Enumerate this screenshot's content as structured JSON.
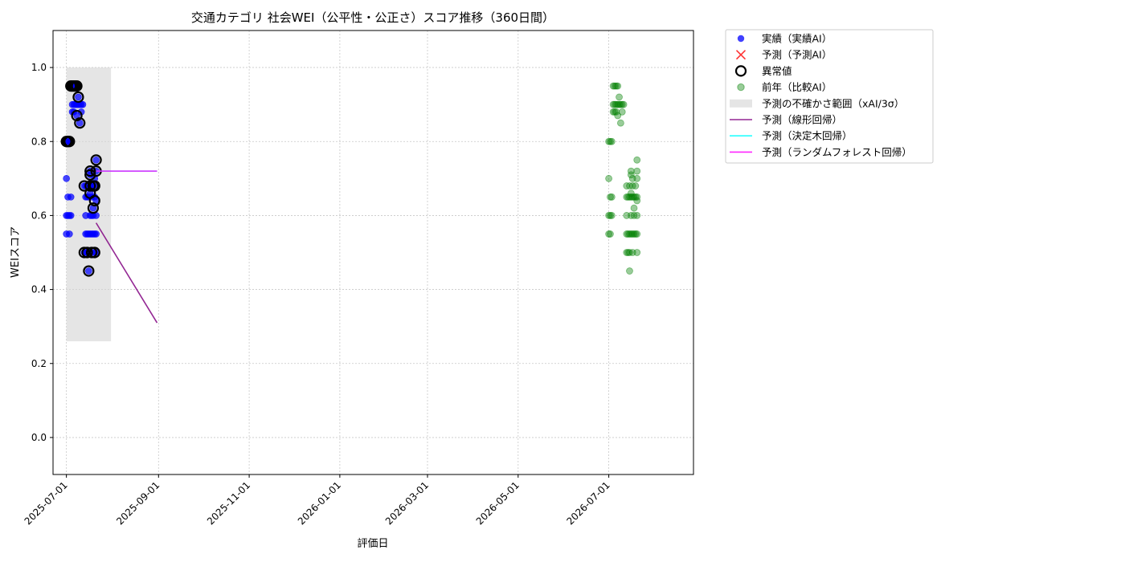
{
  "chart_data": {
    "type": "scatter",
    "title": "交通カテゴリ 社会WEI（公平性・公正さ）スコア推移（360日間）",
    "xlabel": "評価日",
    "ylabel": "WEIスコア",
    "ylim": [
      -0.1,
      1.1
    ],
    "xlim": [
      "2025-06-22",
      "2026-08-27"
    ],
    "yticks": [
      0.0,
      0.2,
      0.4,
      0.6,
      0.8,
      1.0
    ],
    "ytick_labels": [
      "0.0",
      "0.2",
      "0.4",
      "0.6",
      "0.8",
      "1.0"
    ],
    "xticks": [
      "2025-07-01",
      "2025-09-01",
      "2025-11-01",
      "2026-01-01",
      "2026-03-01",
      "2026-05-01",
      "2026-07-01"
    ],
    "grid": true,
    "legend_position": "outside-right",
    "colors": {
      "actual": "#0000ff",
      "predicted": "#ff0000",
      "anomaly_edge": "#000000",
      "prior": "#008000",
      "band": "#d3d3d3",
      "linear": "#800080",
      "tree": "#00ffff",
      "forest": "#ff00ff"
    },
    "legend": [
      {
        "key": "actual",
        "label": "実績（実績AI）",
        "marker": "dot"
      },
      {
        "key": "predicted",
        "label": "予測（予測AI）",
        "marker": "x"
      },
      {
        "key": "anomaly",
        "label": "異常値",
        "marker": "ring"
      },
      {
        "key": "prior",
        "label": "前年（比較AI）",
        "marker": "dot-faded"
      },
      {
        "key": "band",
        "label": "予測の不確かさ範囲（xAI/3σ）",
        "marker": "box"
      },
      {
        "key": "linear",
        "label": "予測（線形回帰）",
        "marker": "line"
      },
      {
        "key": "tree",
        "label": "予測（決定木回帰）",
        "marker": "line"
      },
      {
        "key": "forest",
        "label": "予測（ランダムフォレスト回帰）",
        "marker": "line"
      }
    ],
    "uncertainty_band": {
      "x": [
        "2025-07-01",
        "2025-07-31"
      ],
      "y": [
        0.26,
        1.0
      ]
    },
    "series": [
      {
        "name": "実績（実績AI）",
        "points": [
          [
            "2025-07-01",
            0.8
          ],
          [
            "2025-07-01",
            0.7
          ],
          [
            "2025-07-01",
            0.6
          ],
          [
            "2025-07-01",
            0.55
          ],
          [
            "2025-07-02",
            0.8
          ],
          [
            "2025-07-02",
            0.65
          ],
          [
            "2025-07-02",
            0.6
          ],
          [
            "2025-07-03",
            0.8
          ],
          [
            "2025-07-03",
            0.6
          ],
          [
            "2025-07-03",
            0.55
          ],
          [
            "2025-07-04",
            0.95
          ],
          [
            "2025-07-04",
            0.8
          ],
          [
            "2025-07-04",
            0.65
          ],
          [
            "2025-07-04",
            0.6
          ],
          [
            "2025-07-05",
            0.95
          ],
          [
            "2025-07-05",
            0.9
          ],
          [
            "2025-07-05",
            0.88
          ],
          [
            "2025-07-06",
            0.95
          ],
          [
            "2025-07-06",
            0.9
          ],
          [
            "2025-07-06",
            0.88
          ],
          [
            "2025-07-07",
            0.95
          ],
          [
            "2025-07-07",
            0.9
          ],
          [
            "2025-07-08",
            0.95
          ],
          [
            "2025-07-08",
            0.9
          ],
          [
            "2025-07-08",
            0.87
          ],
          [
            "2025-07-09",
            0.95
          ],
          [
            "2025-07-09",
            0.92
          ],
          [
            "2025-07-09",
            0.9
          ],
          [
            "2025-07-10",
            0.9
          ],
          [
            "2025-07-10",
            0.85
          ],
          [
            "2025-07-11",
            0.9
          ],
          [
            "2025-07-11",
            0.88
          ],
          [
            "2025-07-12",
            0.9
          ],
          [
            "2025-07-13",
            0.68
          ],
          [
            "2025-07-13",
            0.5
          ],
          [
            "2025-07-14",
            0.68
          ],
          [
            "2025-07-14",
            0.65
          ],
          [
            "2025-07-14",
            0.6
          ],
          [
            "2025-07-14",
            0.55
          ],
          [
            "2025-07-14",
            0.5
          ],
          [
            "2025-07-15",
            0.65
          ],
          [
            "2025-07-15",
            0.55
          ],
          [
            "2025-07-15",
            0.5
          ],
          [
            "2025-07-16",
            0.68
          ],
          [
            "2025-07-16",
            0.65
          ],
          [
            "2025-07-16",
            0.55
          ],
          [
            "2025-07-16",
            0.5
          ],
          [
            "2025-07-16",
            0.45
          ],
          [
            "2025-07-17",
            0.72
          ],
          [
            "2025-07-17",
            0.71
          ],
          [
            "2025-07-17",
            0.68
          ],
          [
            "2025-07-17",
            0.66
          ],
          [
            "2025-07-17",
            0.6
          ],
          [
            "2025-07-17",
            0.55
          ],
          [
            "2025-07-18",
            0.68
          ],
          [
            "2025-07-18",
            0.65
          ],
          [
            "2025-07-18",
            0.6
          ],
          [
            "2025-07-18",
            0.55
          ],
          [
            "2025-07-18",
            0.5
          ],
          [
            "2025-07-19",
            0.68
          ],
          [
            "2025-07-19",
            0.62
          ],
          [
            "2025-07-19",
            0.6
          ],
          [
            "2025-07-19",
            0.55
          ],
          [
            "2025-07-20",
            0.7
          ],
          [
            "2025-07-20",
            0.68
          ],
          [
            "2025-07-20",
            0.65
          ],
          [
            "2025-07-20",
            0.55
          ],
          [
            "2025-07-20",
            0.5
          ],
          [
            "2025-07-21",
            0.75
          ],
          [
            "2025-07-21",
            0.72
          ],
          [
            "2025-07-21",
            0.64
          ],
          [
            "2025-07-21",
            0.6
          ],
          [
            "2025-07-21",
            0.55
          ],
          [
            "2025-07-21",
            0.5
          ]
        ]
      },
      {
        "name": "異常値",
        "points": [
          [
            "2025-07-01",
            0.8
          ],
          [
            "2025-07-02",
            0.8
          ],
          [
            "2025-07-03",
            0.8
          ],
          [
            "2025-07-04",
            0.95
          ],
          [
            "2025-07-05",
            0.95
          ],
          [
            "2025-07-06",
            0.95
          ],
          [
            "2025-07-07",
            0.95
          ],
          [
            "2025-07-08",
            0.95
          ],
          [
            "2025-07-08",
            0.87
          ],
          [
            "2025-07-09",
            0.92
          ],
          [
            "2025-07-10",
            0.85
          ],
          [
            "2025-07-13",
            0.68
          ],
          [
            "2025-07-13",
            0.5
          ],
          [
            "2025-07-15",
            0.5
          ],
          [
            "2025-07-16",
            0.45
          ],
          [
            "2025-07-17",
            0.72
          ],
          [
            "2025-07-17",
            0.71
          ],
          [
            "2025-07-17",
            0.68
          ],
          [
            "2025-07-17",
            0.66
          ],
          [
            "2025-07-18",
            0.5
          ],
          [
            "2025-07-19",
            0.68
          ],
          [
            "2025-07-19",
            0.62
          ],
          [
            "2025-07-20",
            0.68
          ],
          [
            "2025-07-20",
            0.64
          ],
          [
            "2025-07-20",
            0.5
          ],
          [
            "2025-07-21",
            0.75
          ],
          [
            "2025-07-21",
            0.72
          ]
        ]
      },
      {
        "name": "前年（比較AI）",
        "points": [
          [
            "2026-07-01",
            0.8
          ],
          [
            "2026-07-01",
            0.7
          ],
          [
            "2026-07-01",
            0.6
          ],
          [
            "2026-07-01",
            0.55
          ],
          [
            "2026-07-02",
            0.8
          ],
          [
            "2026-07-02",
            0.65
          ],
          [
            "2026-07-02",
            0.6
          ],
          [
            "2026-07-02",
            0.55
          ],
          [
            "2026-07-03",
            0.8
          ],
          [
            "2026-07-03",
            0.65
          ],
          [
            "2026-07-03",
            0.6
          ],
          [
            "2026-07-04",
            0.95
          ],
          [
            "2026-07-04",
            0.9
          ],
          [
            "2026-07-04",
            0.88
          ],
          [
            "2026-07-05",
            0.95
          ],
          [
            "2026-07-05",
            0.9
          ],
          [
            "2026-07-05",
            0.88
          ],
          [
            "2026-07-06",
            0.95
          ],
          [
            "2026-07-06",
            0.9
          ],
          [
            "2026-07-06",
            0.88
          ],
          [
            "2026-07-07",
            0.95
          ],
          [
            "2026-07-07",
            0.9
          ],
          [
            "2026-07-07",
            0.87
          ],
          [
            "2026-07-08",
            0.92
          ],
          [
            "2026-07-08",
            0.9
          ],
          [
            "2026-07-09",
            0.9
          ],
          [
            "2026-07-09",
            0.85
          ],
          [
            "2026-07-10",
            0.9
          ],
          [
            "2026-07-10",
            0.88
          ],
          [
            "2026-07-11",
            0.9
          ],
          [
            "2026-07-13",
            0.68
          ],
          [
            "2026-07-13",
            0.65
          ],
          [
            "2026-07-13",
            0.6
          ],
          [
            "2026-07-13",
            0.55
          ],
          [
            "2026-07-13",
            0.5
          ],
          [
            "2026-07-14",
            0.65
          ],
          [
            "2026-07-14",
            0.55
          ],
          [
            "2026-07-14",
            0.5
          ],
          [
            "2026-07-15",
            0.68
          ],
          [
            "2026-07-15",
            0.65
          ],
          [
            "2026-07-15",
            0.55
          ],
          [
            "2026-07-15",
            0.5
          ],
          [
            "2026-07-15",
            0.45
          ],
          [
            "2026-07-16",
            0.72
          ],
          [
            "2026-07-16",
            0.71
          ],
          [
            "2026-07-16",
            0.66
          ],
          [
            "2026-07-16",
            0.65
          ],
          [
            "2026-07-16",
            0.6
          ],
          [
            "2026-07-16",
            0.55
          ],
          [
            "2026-07-17",
            0.7
          ],
          [
            "2026-07-17",
            0.68
          ],
          [
            "2026-07-17",
            0.65
          ],
          [
            "2026-07-17",
            0.55
          ],
          [
            "2026-07-17",
            0.5
          ],
          [
            "2026-07-18",
            0.65
          ],
          [
            "2026-07-18",
            0.62
          ],
          [
            "2026-07-18",
            0.6
          ],
          [
            "2026-07-18",
            0.55
          ],
          [
            "2026-07-19",
            0.68
          ],
          [
            "2026-07-19",
            0.65
          ],
          [
            "2026-07-19",
            0.55
          ],
          [
            "2026-07-20",
            0.75
          ],
          [
            "2026-07-20",
            0.72
          ],
          [
            "2026-07-20",
            0.7
          ],
          [
            "2026-07-20",
            0.65
          ],
          [
            "2026-07-20",
            0.64
          ],
          [
            "2026-07-20",
            0.6
          ],
          [
            "2026-07-20",
            0.55
          ],
          [
            "2026-07-20",
            0.5
          ]
        ]
      },
      {
        "name": "予測（線形回帰）",
        "line": [
          [
            "2025-07-21",
            0.58
          ],
          [
            "2025-08-31",
            0.31
          ]
        ]
      },
      {
        "name": "予測（決定木回帰）",
        "line": [
          [
            "2025-07-21",
            0.72
          ],
          [
            "2025-08-31",
            0.72
          ]
        ]
      },
      {
        "name": "予測（ランダムフォレスト回帰）",
        "line": [
          [
            "2025-07-21",
            0.72
          ],
          [
            "2025-08-31",
            0.72
          ]
        ]
      }
    ]
  }
}
